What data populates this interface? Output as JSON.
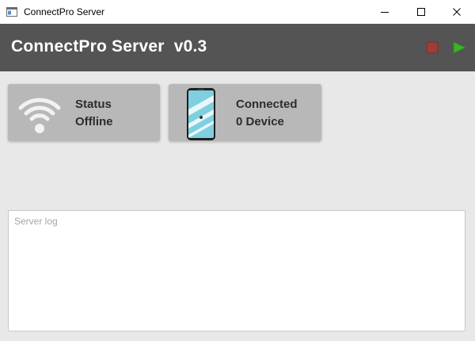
{
  "window": {
    "title": "ConnectPro Server"
  },
  "header": {
    "title": "ConnectPro Server  v0.3",
    "stop_icon": "stop-icon",
    "play_icon": "play-icon",
    "stop_color": "#9e3d3d",
    "play_color": "#3cb528"
  },
  "status_card": {
    "icon": "wifi-icon",
    "label": "Status",
    "value": "Offline"
  },
  "devices_card": {
    "icon": "phone-icon",
    "label": "Connected",
    "value": "0 Device"
  },
  "log": {
    "placeholder": "Server log",
    "value": ""
  },
  "colors": {
    "header_bg": "#545454",
    "card_bg": "#b8b8b8",
    "window_bg": "#e8e8e8"
  }
}
